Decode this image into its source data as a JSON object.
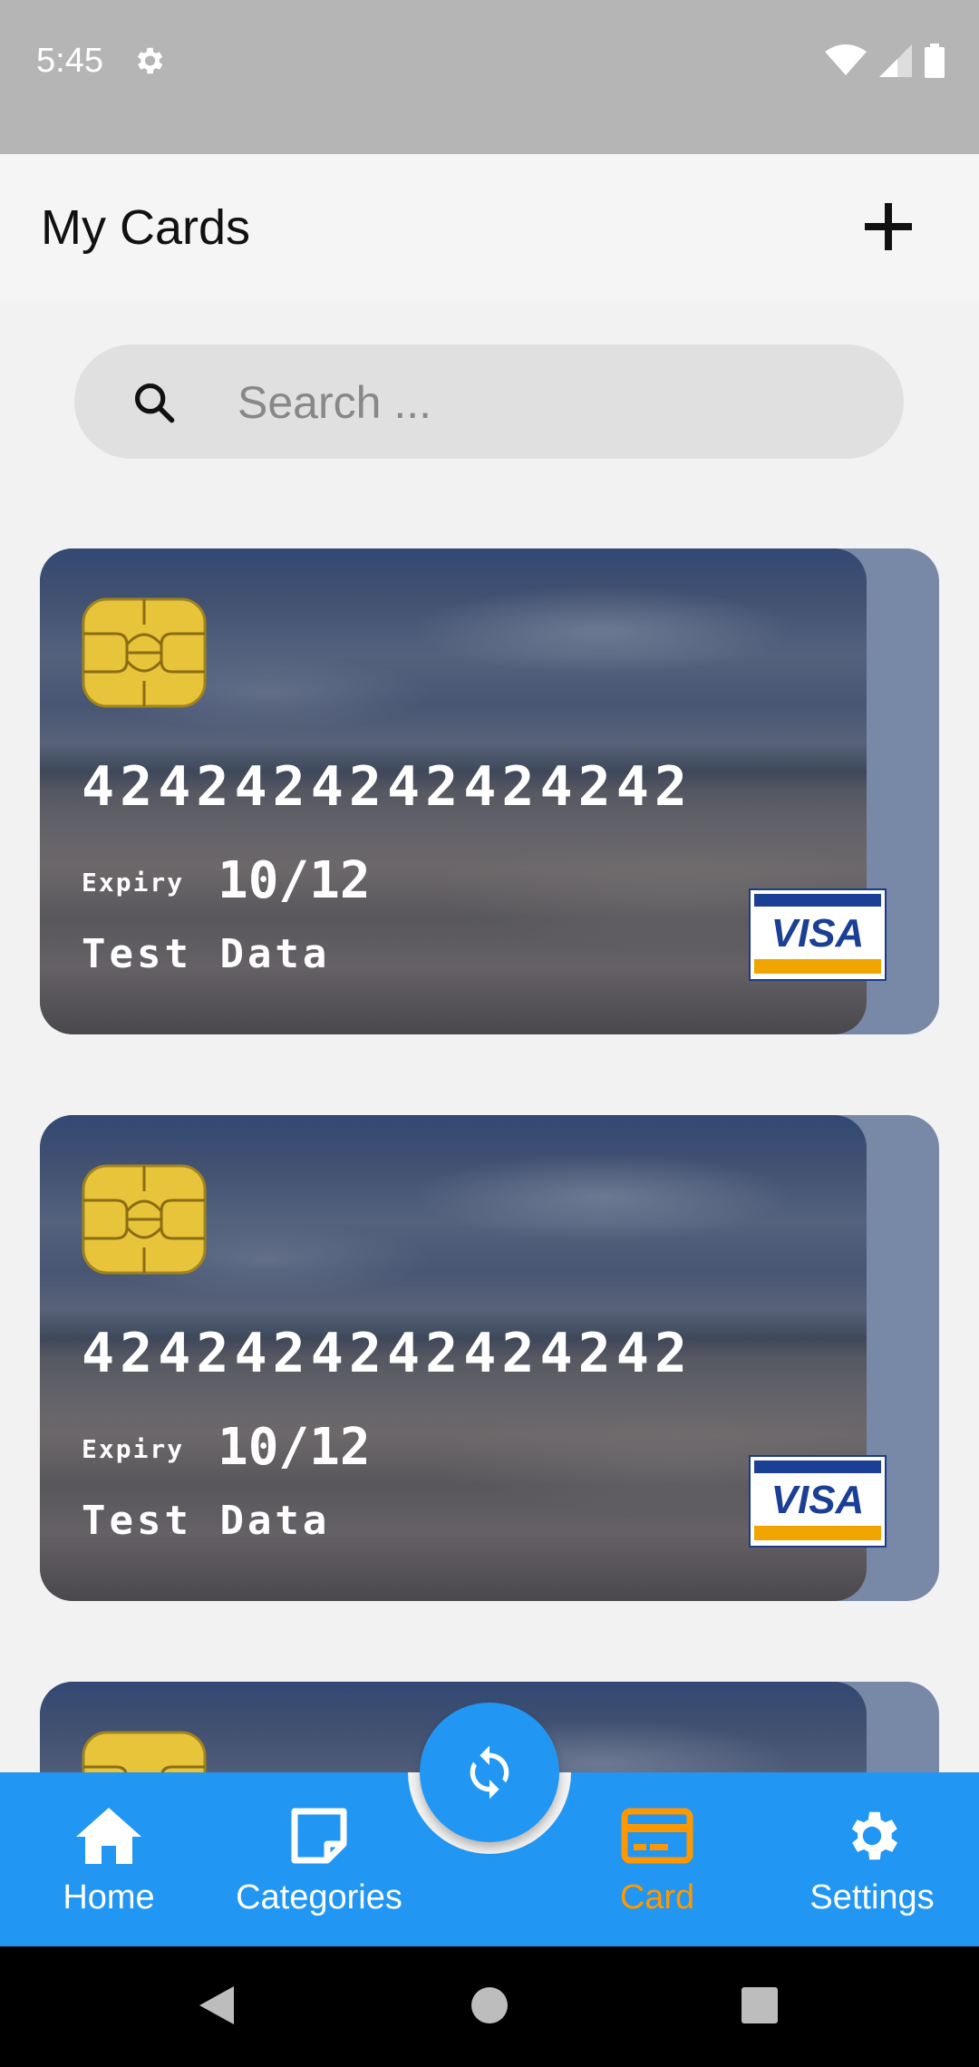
{
  "status_bar": {
    "time": "5:45"
  },
  "header": {
    "title": "My Cards",
    "add_icon": "plus-icon"
  },
  "search": {
    "placeholder": "Search ...",
    "value": ""
  },
  "cards": [
    {
      "number": "4242424242424242",
      "expiry_label": "Expiry",
      "expiry": "10/12",
      "holder": "Test Data",
      "network": "VISA"
    },
    {
      "number": "4242424242424242",
      "expiry_label": "Expiry",
      "expiry": "10/12",
      "holder": "Test Data",
      "network": "VISA"
    }
  ],
  "bottom_nav": {
    "items": [
      {
        "label": "Home",
        "icon": "home-icon"
      },
      {
        "label": "Categories",
        "icon": "note-icon"
      },
      {
        "label": "Card",
        "icon": "credit-card-icon"
      },
      {
        "label": "Settings",
        "icon": "gear-icon"
      }
    ],
    "active": "Card",
    "fab_icon": "sync-icon"
  },
  "colors": {
    "primary": "#2196f3",
    "active": "#ff9800",
    "card_back": "#7889a8",
    "chip": "#e8c43a"
  }
}
